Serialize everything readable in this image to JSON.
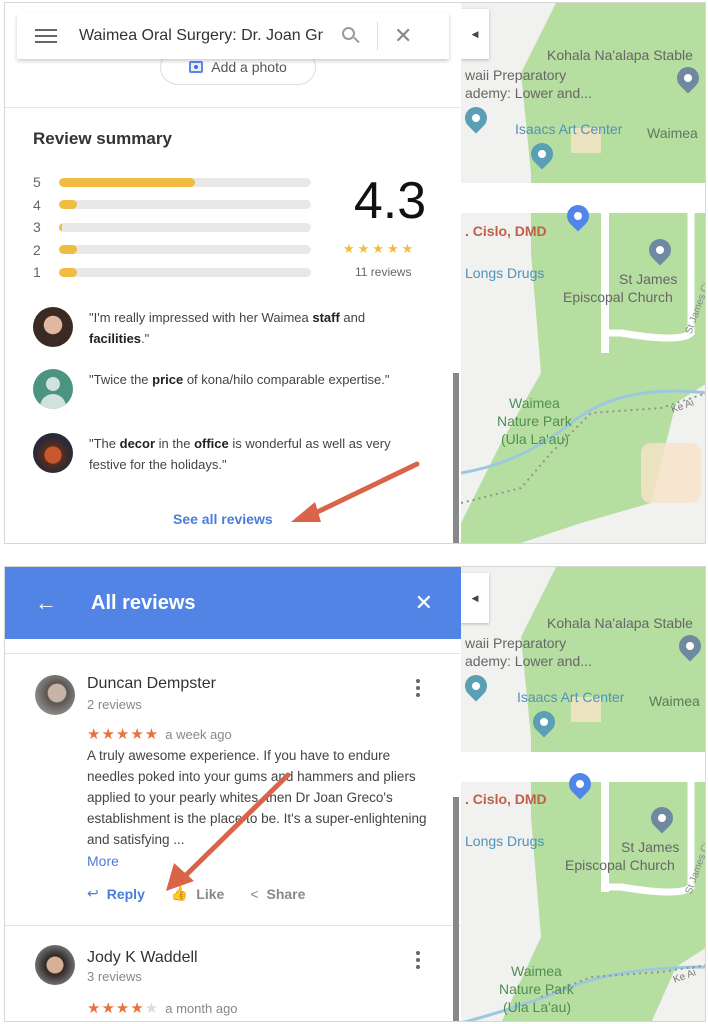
{
  "screenshot1": {
    "search": {
      "query": "Waimea Oral Surgery: Dr. Joan Gr",
      "menu_icon": "hamburger-icon",
      "search_icon": "search-icon",
      "close_icon": "close-icon"
    },
    "add_photo_label": "Add a photo",
    "review_summary": {
      "title": "Review summary",
      "histogram": [
        {
          "stars": "5",
          "fraction": 0.54
        },
        {
          "stars": "4",
          "fraction": 0.07
        },
        {
          "stars": "3",
          "fraction": 0.01
        },
        {
          "stars": "2",
          "fraction": 0.07
        },
        {
          "stars": "1",
          "fraction": 0.07
        }
      ],
      "rating": "4.3",
      "stars_display": "★★★★★",
      "review_count": "11 reviews"
    },
    "snippets": [
      {
        "pre": "\"I'm really impressed with her Waimea ",
        "bold1": "staff",
        "mid": " and ",
        "bold2": "facilities",
        "post": ".\""
      },
      {
        "pre": "\"Twice the ",
        "bold1": "price",
        "mid": " of kona/hilo comparable expertise.\"",
        "bold2": "",
        "post": ""
      },
      {
        "pre": "\"The ",
        "bold1": "decor",
        "mid": " in the ",
        "bold2": "office",
        "post": " is wonderful as well as very festive for the holidays.\""
      }
    ],
    "see_all_label": "See all reviews"
  },
  "screenshot2": {
    "header": {
      "back_icon": "←",
      "title": "All reviews",
      "close_icon": "✕"
    },
    "reviews": [
      {
        "name": "Duncan Dempster",
        "count": "2 reviews",
        "rating": 5,
        "stars_on": "★★★★★",
        "stars_off": "",
        "date": "a week ago",
        "text": "A truly awesome experience. If you have to endure needles poked into your gums and hammers and pliers applied to your pearly whites, then Dr Joan Greco's establishment is the place to be. It's a super-enlightening and satisfying ...",
        "more_label": "More"
      },
      {
        "name": "Jody K Waddell",
        "count": "3 reviews",
        "rating": 4,
        "stars_on": "★★★★",
        "stars_off": "★",
        "date": "a month ago"
      }
    ],
    "actions": {
      "reply": "Reply",
      "like": "Like",
      "share": "Share"
    }
  },
  "map": {
    "collapse_icon": "◀",
    "labels": {
      "stables": "Kohala Na'alapa Stable",
      "prep1": "waii Preparatory",
      "prep2": "ademy: Lower and...",
      "art_center": "Isaacs Art Center",
      "waimea": "Waimea",
      "dentist": ". Cislo, DMD",
      "drugs": "Longs Drugs",
      "church1": "St James",
      "church2": "Episcopal Church",
      "street": "St James Ci",
      "park1": "Waimea",
      "park2": "Nature Park",
      "park3": "(Ula La'au)",
      "trail": "Ke Ai"
    },
    "colors": {
      "park": "#b7dea1",
      "land": "#f1f1ef",
      "road": "#ffffff",
      "pin_blue": "#4f86e8",
      "pin_teal": "#5a9fb3",
      "pin_gray": "#6f8aa0"
    }
  },
  "colors": {
    "accent_blue": "#5284e6",
    "link_blue": "#4a7ddb",
    "summary_star": "#f1bc42",
    "review_star": "#e7733e",
    "annotation_arrow": "#d9644a"
  }
}
